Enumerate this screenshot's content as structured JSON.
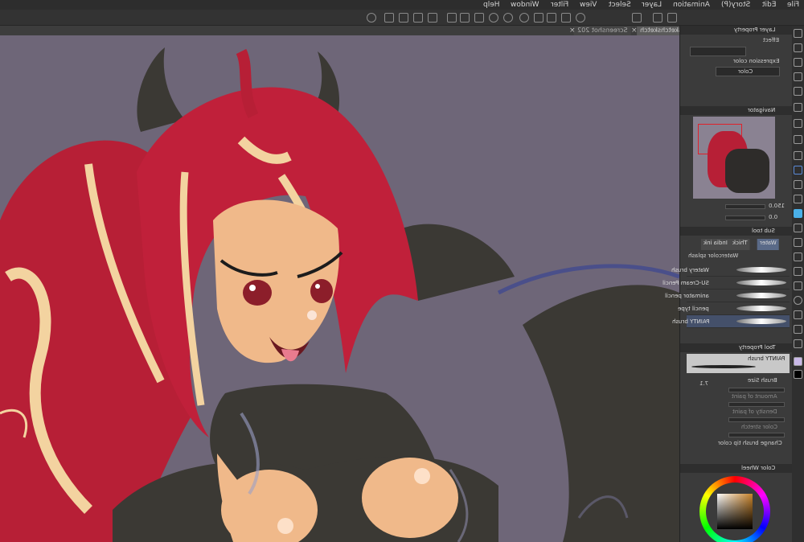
{
  "menu": [
    "File",
    "Edit",
    "Story(P)",
    "Animation",
    "Layer",
    "Select",
    "View",
    "Filter",
    "Window",
    "Help"
  ],
  "tabs": [
    {
      "label": "sketchsketch",
      "active": true
    },
    {
      "label": "Screenshot 202",
      "active": false
    }
  ],
  "layer_property": {
    "title": "Layer Property",
    "effect_label": "Effect",
    "expression_color_label": "Expression color",
    "expression_color_value": "Color"
  },
  "navigator": {
    "title": "Navigator",
    "zoom": "150.0",
    "angle": "0.0"
  },
  "sub_tool": {
    "title": "Sub tool",
    "groups": [
      "Water",
      "Thick",
      "India ink",
      "Watercolor splash"
    ],
    "brushes": [
      {
        "name": "Watery brush",
        "selected": false
      },
      {
        "name": "SU-Cream Pencil",
        "selected": false
      },
      {
        "name": "animator pencil",
        "selected": false
      },
      {
        "name": "pencil type",
        "selected": false
      },
      {
        "name": "PAINTY brush",
        "selected": true
      }
    ]
  },
  "tool_property": {
    "title": "Tool Property",
    "current_brush": "PAINTY brush",
    "brush_size_label": "Brush Size",
    "brush_size_value": "7.1",
    "amount_label": "Amount of paint",
    "density_label": "Density of paint",
    "stretch_label": "Color stretch",
    "tip_color_label": "Change brush tip color"
  },
  "color_wheel": {
    "title": "Color Wheel",
    "hue": "#c8832a"
  }
}
